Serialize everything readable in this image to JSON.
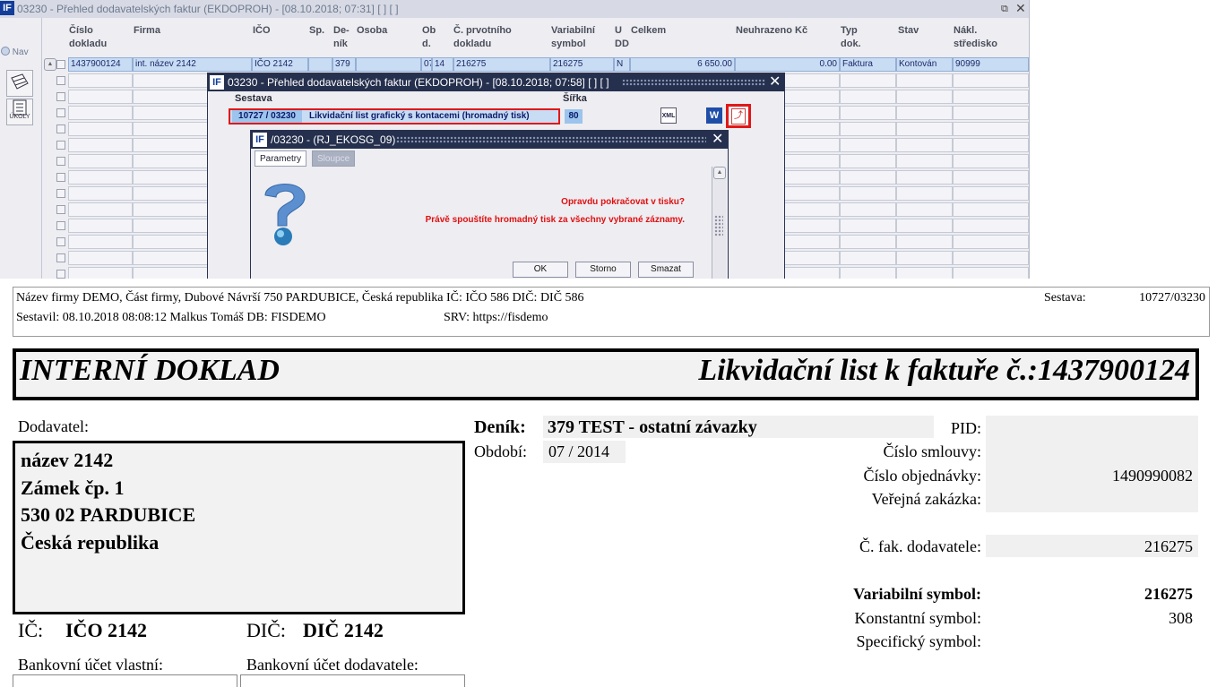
{
  "app": {
    "title": "03230 - Přehled dodavatelských faktur (EKDOPROH) - [08.10.2018; 07:31]  [ ]  [ ]",
    "logo": "IF",
    "nav_label": "Nav",
    "tool_label": "ÚKOLY"
  },
  "grid": {
    "headers": [
      "Číslo\ndokladu",
      "Firma",
      "IČO",
      "Sp.",
      "De-\nník",
      "Osoba",
      "Ob\nd.",
      "Č. prvotního\ndokladu",
      "Variabilní\nsymbol",
      "U\nDD",
      "Celkem",
      "Neuhrazeno Kč",
      "Typ\ndok.",
      "Stav",
      "Nákl.\nstředisko"
    ],
    "first_row": [
      "1437900124",
      "int. název 2142",
      "IČO 2142",
      "",
      "379",
      "",
      "07",
      "14",
      "216275",
      "216275",
      "N",
      "6 650.00",
      "0.00",
      "Faktura",
      "Kontován",
      "90999"
    ]
  },
  "dialog1": {
    "title": "03230 - Přehled dodavatelských faktur (EKDOPROH) - [08.10.2018; 07:58]  [ ]  [ ]",
    "sestava_label": "Sestava",
    "sirka_label": "Šířka",
    "report_code": "10727 / 03230",
    "report_name": "Likvidační list grafický s kontacemi (hromadný tisk)",
    "width_value": "80",
    "xml_icon_label": "XML",
    "word_icon_label": "W"
  },
  "dialog2": {
    "title": "/03230 - (RJ_EKOSG_09)",
    "tab_parametry": "Parametry",
    "tab_sloupce": "Sloupce",
    "msg1": "Opravdu pokračovat v tisku?",
    "msg2": "Právě spouštíte hromadný tisk za všechny vybrané záznamy.",
    "ok": "OK",
    "storno": "Storno",
    "smazat": "Smazat"
  },
  "report": {
    "header_line1": "Název firmy DEMO, Část firmy, Dubové Návrší 750 PARDUBICE, Česká republika  IČ: IČO 586  DIČ: DIČ 586",
    "header_line2": "Sestavil: 08.10.2018 08:08:12 Malkus Tomáš  DB: FISDEMO",
    "srv": "SRV: https://fisdemo",
    "sestava_label": "Sestava:",
    "sestava_value": "10727/03230",
    "banner_left": "INTERNÍ DOKLAD",
    "banner_right": "Likvidační list k faktuře č.:1437900124",
    "dodavatel_label": "Dodavatel:",
    "address": [
      "název 2142",
      "Zámek čp. 1",
      "530 02 PARDUBICE",
      "Česká republika"
    ],
    "ic_label": "IČ:",
    "ic_value": "IČO 2142",
    "dic_label": "DIČ:",
    "dic_value": "DIČ 2142",
    "bank_own": "Bankovní účet vlastní:",
    "bank_supplier": "Bankovní účet dodavatele:",
    "denik_label": "Deník:",
    "denik_value": "379 TEST - ostatní závazky",
    "obdobi_label": "Období:",
    "obdobi_value": "07 / 2014",
    "pid_label": "PID:",
    "smlouva_label": "Číslo smlouvy:",
    "objednavka_label": "Číslo objednávky:",
    "objednavka_value": "1490990082",
    "zakazka_label": "Veřejná zakázka:",
    "fak_label": "Č. fak. dodavatele:",
    "fak_value": "216275",
    "vs_label": "Variabilní symbol:",
    "vs_value": "216275",
    "ks_label": "Konstantní symbol:",
    "ks_value": "308",
    "ss_label": "Specifický symbol:"
  }
}
